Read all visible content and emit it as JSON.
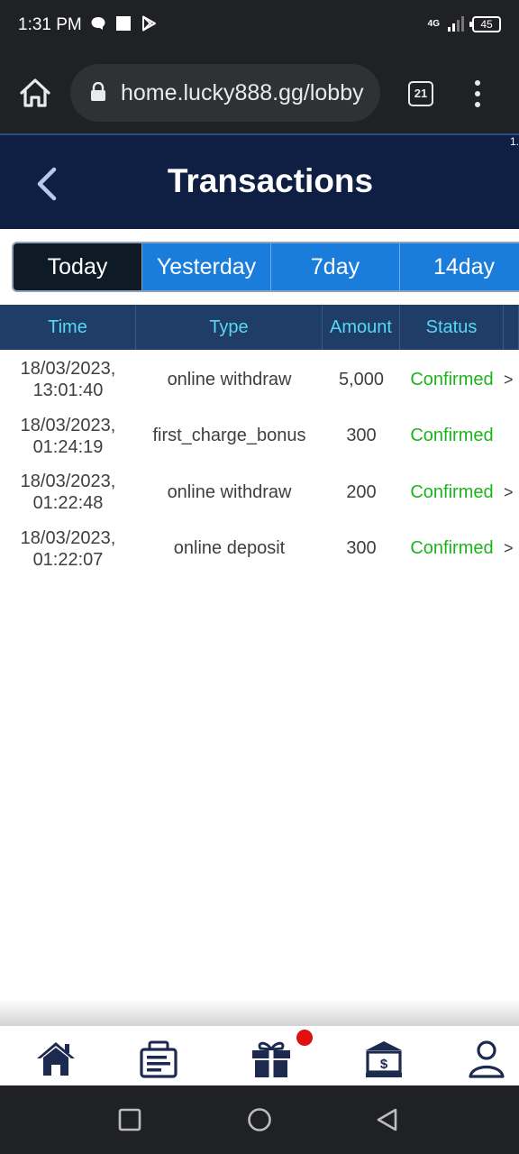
{
  "status_bar": {
    "time": "1:31 PM",
    "network": "4G",
    "battery": "45"
  },
  "browser": {
    "url": "home.lucky888.gg/lobby",
    "tab_count": "21"
  },
  "header": {
    "title": "Transactions",
    "corner_text": "1."
  },
  "period_tabs": [
    {
      "label": "Today",
      "active": true
    },
    {
      "label": "Yesterday",
      "active": false
    },
    {
      "label": "7day",
      "active": false
    },
    {
      "label": "14day",
      "active": false
    }
  ],
  "table": {
    "columns": [
      "Time",
      "Type",
      "Amount",
      "Status"
    ],
    "rows": [
      {
        "date": "18/03/2023,",
        "time": "13:01:40",
        "type": "online withdraw",
        "amount": "5,000",
        "status": "Confirmed",
        "arrow": ">"
      },
      {
        "date": "18/03/2023,",
        "time": "01:24:19",
        "type": "first_charge_bonus",
        "amount": "300",
        "status": "Confirmed",
        "arrow": ""
      },
      {
        "date": "18/03/2023,",
        "time": "01:22:48",
        "type": "online withdraw",
        "amount": "200",
        "status": "Confirmed",
        "arrow": ">"
      },
      {
        "date": "18/03/2023,",
        "time": "01:22:07",
        "type": "online deposit",
        "amount": "300",
        "status": "Confirmed",
        "arrow": ">"
      }
    ]
  },
  "bottom_nav": {
    "items": [
      "home-icon",
      "news-board-icon",
      "gift-icon",
      "bank-icon",
      "user-icon"
    ],
    "gift_has_badge": true
  },
  "colors": {
    "header_bg": "#0f1f44",
    "tab_blue": "#1a7ddb",
    "tab_active": "#0e1a26",
    "table_header_bg": "#1f3d66",
    "table_header_text": "#57d8f4",
    "status_confirmed": "#1bb51b",
    "icon_navy": "#1b2a4e",
    "badge_red": "#e01010"
  }
}
